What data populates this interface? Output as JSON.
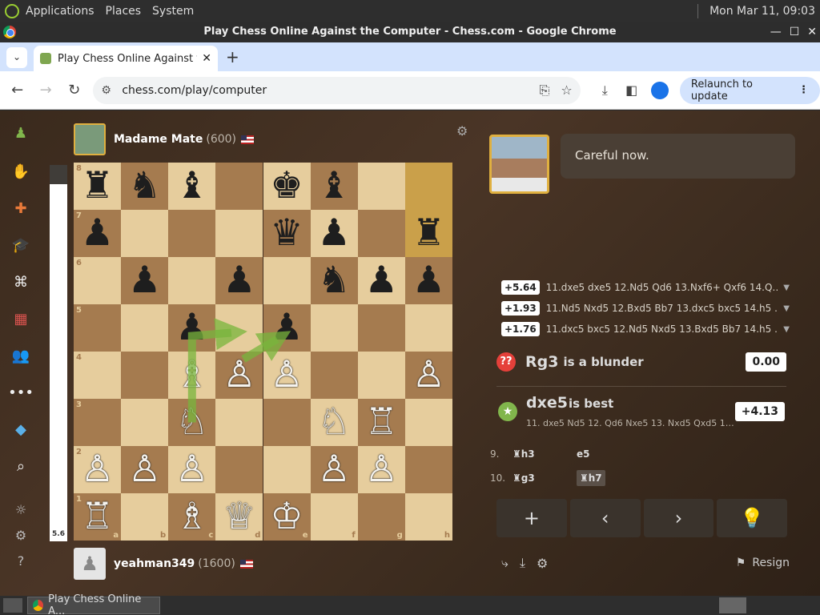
{
  "os": {
    "menus": [
      "Applications",
      "Places",
      "System"
    ],
    "datetime": "Mon Mar 11, 09:03"
  },
  "window": {
    "title": "Play Chess Online Against the Computer - Chess.com - Google Chrome",
    "controls": [
      "—",
      "☐",
      "✕"
    ]
  },
  "tabs": {
    "active_title": "Play Chess Online Against the Computer",
    "close": "✕",
    "new_tab": "+",
    "dropdown": "⌄"
  },
  "toolbar": {
    "url": "chess.com/play/computer",
    "relaunch_label": "Relaunch to update"
  },
  "opponent": {
    "name": "Madame Mate",
    "rating": "(600)"
  },
  "user": {
    "name": "yeahman349",
    "rating": "(1600)"
  },
  "eval": {
    "label": "5.6",
    "white_fraction": 0.95
  },
  "board": {
    "files": [
      "a",
      "b",
      "c",
      "d",
      "e",
      "f",
      "g",
      "h"
    ],
    "ranks": [
      "8",
      "7",
      "6",
      "5",
      "4",
      "3",
      "2",
      "1"
    ],
    "highlight_squares": [
      "h8",
      "h7"
    ],
    "pieces": [
      {
        "sq": "a8",
        "p": "♜",
        "c": "b"
      },
      {
        "sq": "b8",
        "p": "♞",
        "c": "b"
      },
      {
        "sq": "c8",
        "p": "♝",
        "c": "b"
      },
      {
        "sq": "e8",
        "p": "♚",
        "c": "b"
      },
      {
        "sq": "f8",
        "p": "♝",
        "c": "b"
      },
      {
        "sq": "a7",
        "p": "♟",
        "c": "b"
      },
      {
        "sq": "e7",
        "p": "♛",
        "c": "b"
      },
      {
        "sq": "f7",
        "p": "♟",
        "c": "b"
      },
      {
        "sq": "h7",
        "p": "♜",
        "c": "b"
      },
      {
        "sq": "b6",
        "p": "♟",
        "c": "b"
      },
      {
        "sq": "d6",
        "p": "♟",
        "c": "b"
      },
      {
        "sq": "f6",
        "p": "♞",
        "c": "b"
      },
      {
        "sq": "g6",
        "p": "♟",
        "c": "b"
      },
      {
        "sq": "h6",
        "p": "♟",
        "c": "b"
      },
      {
        "sq": "c5",
        "p": "♟",
        "c": "b"
      },
      {
        "sq": "e5",
        "p": "♟",
        "c": "b"
      },
      {
        "sq": "c4",
        "p": "♗",
        "c": "w"
      },
      {
        "sq": "d4",
        "p": "♙",
        "c": "w"
      },
      {
        "sq": "e4",
        "p": "♙",
        "c": "w"
      },
      {
        "sq": "h4",
        "p": "♙",
        "c": "w"
      },
      {
        "sq": "c3",
        "p": "♘",
        "c": "w"
      },
      {
        "sq": "f3",
        "p": "♘",
        "c": "w"
      },
      {
        "sq": "g3",
        "p": "♖",
        "c": "w"
      },
      {
        "sq": "a2",
        "p": "♙",
        "c": "w"
      },
      {
        "sq": "b2",
        "p": "♙",
        "c": "w"
      },
      {
        "sq": "c2",
        "p": "♙",
        "c": "w"
      },
      {
        "sq": "f2",
        "p": "♙",
        "c": "w"
      },
      {
        "sq": "g2",
        "p": "♙",
        "c": "w"
      },
      {
        "sq": "a1",
        "p": "♖",
        "c": "w"
      },
      {
        "sq": "c1",
        "p": "♗",
        "c": "w"
      },
      {
        "sq": "d1",
        "p": "♕",
        "c": "w"
      },
      {
        "sq": "e1",
        "p": "♔",
        "c": "w"
      }
    ],
    "arrows": [
      {
        "from": "c3",
        "to": "d5"
      },
      {
        "from": "d4",
        "to": "e5"
      }
    ]
  },
  "coach": {
    "message": "Careful now."
  },
  "engine_lines": [
    {
      "score": "+5.64",
      "moves": "11.dxe5 dxe5 12.Nd5 Qd6 13.Nxf6+ Qxf6 14.Q…"
    },
    {
      "score": "+1.93",
      "moves": "11.Nd5 Nxd5 12.Bxd5 Bb7 13.dxc5 bxc5 14.h5 …"
    },
    {
      "score": "+1.76",
      "moves": "11.dxc5 bxc5 12.Nd5 Nxd5 13.Bxd5 Bb7 14.h5 …"
    }
  ],
  "blunder": {
    "icon": "??",
    "move": "Rg3",
    "text": "is a blunder",
    "score": "0.00"
  },
  "best": {
    "icon": "★",
    "move": "dxe5",
    "text": "is best",
    "line": "11. dxe5 Nd5 12. Qd6 Nxe5 13. Nxd5 Qxd5 1…",
    "score": "+4.13"
  },
  "moves": [
    {
      "num": "9.",
      "white": "♜h3",
      "black": "e5"
    },
    {
      "num": "10.",
      "white": "♜g3",
      "black": "♜h7"
    }
  ],
  "controls": [
    "+",
    "‹",
    "›",
    "💡"
  ],
  "resign_label": "Resign",
  "taskbar": {
    "item_label": "Play Chess Online A..."
  }
}
